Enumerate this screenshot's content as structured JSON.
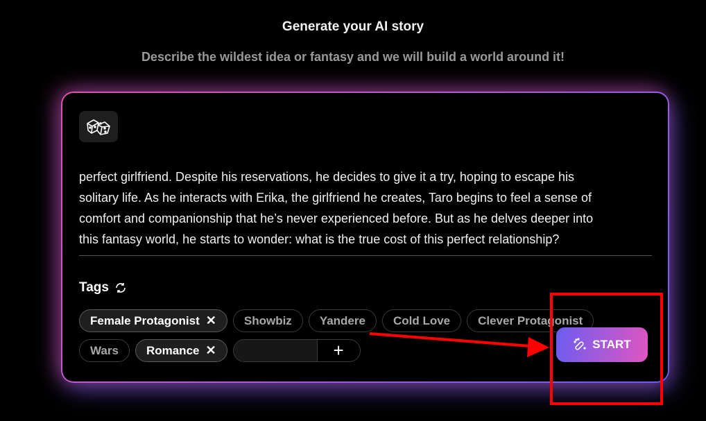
{
  "header": {
    "title": "Generate your AI story",
    "subtitle": "Describe the wildest idea or fantasy and we will build a world around it!"
  },
  "story": {
    "lines": [
      "perfect girlfriend. Despite his reservations, he decides to give it a try, hoping to escape his",
      "solitary life. As he interacts with Erika, the girlfriend he creates, Taro begins to feel a sense of",
      "comfort and companionship that he’s never experienced before. But as he delves deeper into",
      "this fantasy world, he starts to wonder: what is the true cost of this perfect relationship?"
    ]
  },
  "tags": {
    "label": "Tags",
    "row1": [
      {
        "label": "Female Protagonist",
        "selected": true,
        "remove": "✕"
      },
      {
        "label": "Showbiz",
        "selected": false
      },
      {
        "label": "Yandere",
        "selected": false
      },
      {
        "label": "Cold Love",
        "selected": false
      },
      {
        "label": "Clever Protagonist",
        "selected": false
      }
    ],
    "row2": [
      {
        "label": "Wars",
        "selected": false
      },
      {
        "label": "Romance",
        "selected": true,
        "remove": "✕"
      }
    ],
    "add_value": "",
    "add_label": "+"
  },
  "start": {
    "label": "START",
    "icon": "magic-wand-icon"
  },
  "colors": {
    "accent_start": "#6b5cf0",
    "accent_end": "#e055c0",
    "annotation": "#ff0000"
  }
}
